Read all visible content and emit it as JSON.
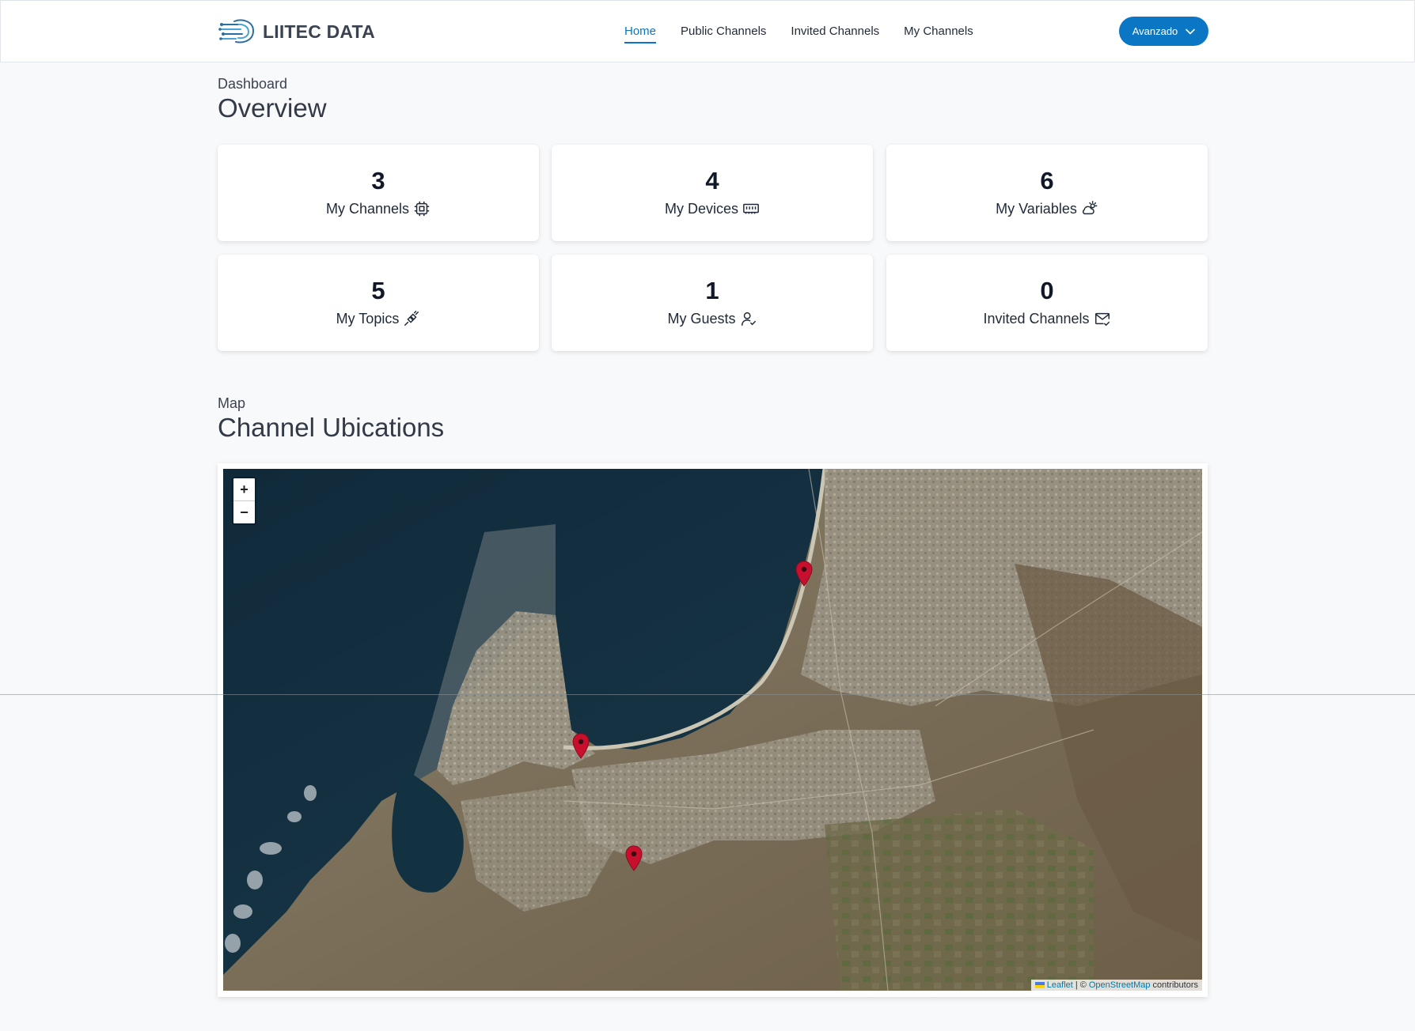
{
  "header": {
    "brand_name": "LIITEC DATA",
    "nav": [
      {
        "label": "Home",
        "active": true
      },
      {
        "label": "Public Channels",
        "active": false
      },
      {
        "label": "Invited Channels",
        "active": false
      },
      {
        "label": "My Channels",
        "active": false
      }
    ],
    "user_menu_label": "Avanzado",
    "accent_color": "#0b76c4"
  },
  "dashboard": {
    "kicker": "Dashboard",
    "title": "Overview",
    "stats": [
      {
        "value": "3",
        "label": "My Channels",
        "icon": "cpu-chip-icon"
      },
      {
        "value": "4",
        "label": "My Devices",
        "icon": "memory-module-icon"
      },
      {
        "value": "6",
        "label": "My Variables",
        "icon": "weather-cloud-sun-icon"
      },
      {
        "value": "5",
        "label": "My Topics",
        "icon": "plug-connection-icon"
      },
      {
        "value": "1",
        "label": "My Guests",
        "icon": "user-check-icon"
      },
      {
        "value": "0",
        "label": "Invited Channels",
        "icon": "mail-check-icon"
      }
    ]
  },
  "map_section": {
    "kicker": "Map",
    "title": "Channel Ubications",
    "zoom_in": "+",
    "zoom_out": "−",
    "attribution": {
      "leaflet": "Leaflet",
      "separator": "| ©",
      "osm": "OpenStreetMap",
      "suffix": "contributors"
    },
    "marker_count": 3,
    "marker_color": "#c8102e"
  }
}
